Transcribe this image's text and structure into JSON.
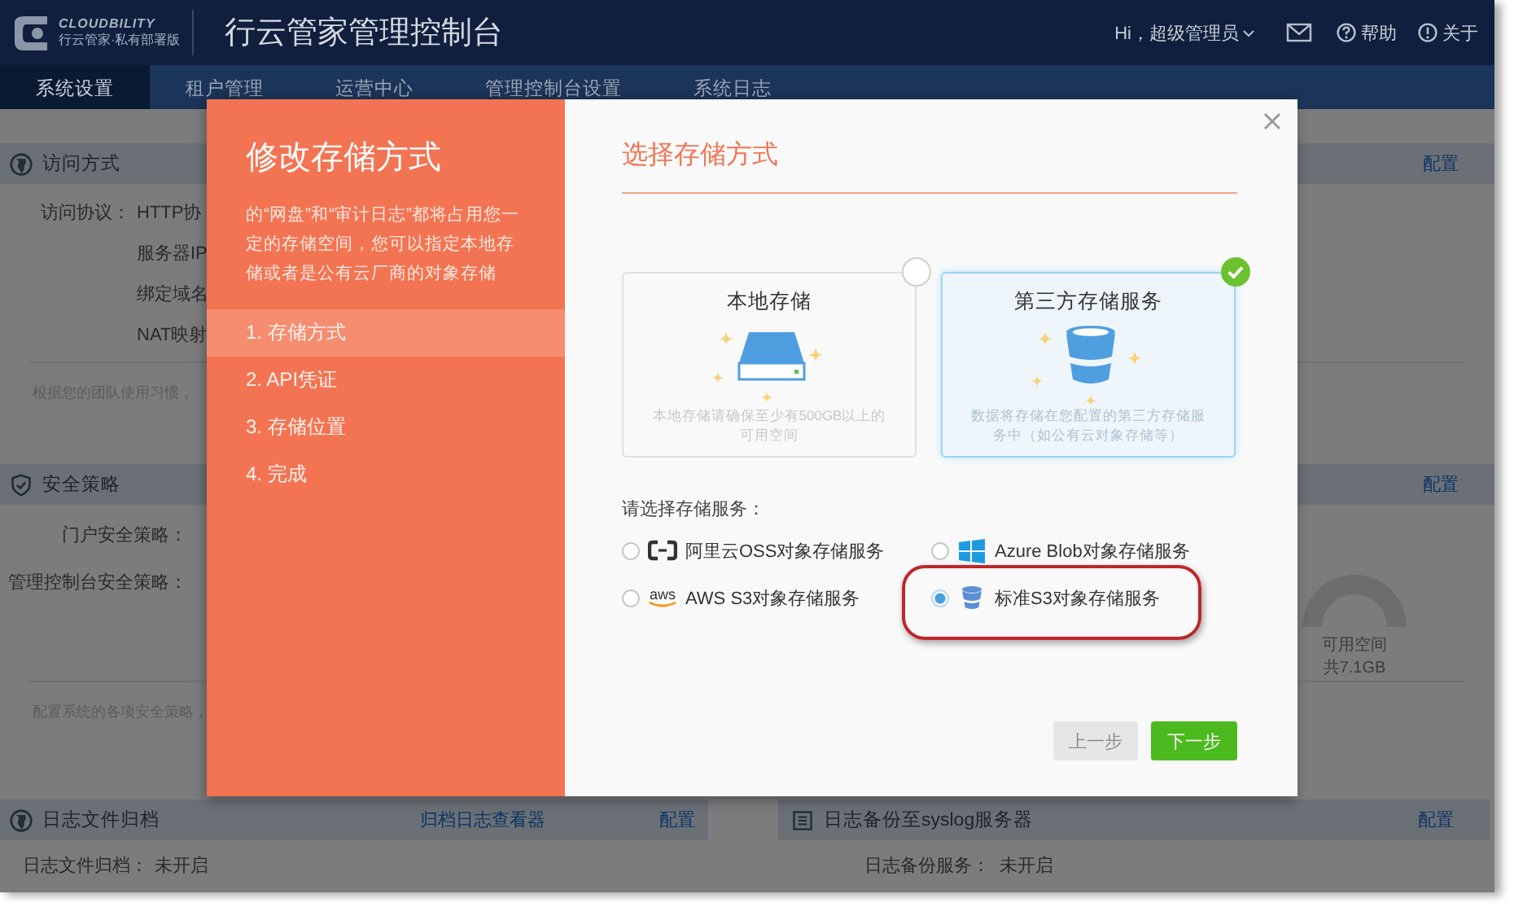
{
  "header": {
    "logo": {
      "name": "CLOUDBILITY",
      "tagline": "行云管家·私有部署版"
    },
    "title": "行云管家管理控制台",
    "user": "Hi，超级管理员",
    "links": [
      {
        "kind": "mail"
      },
      {
        "kind": "help",
        "label": "帮助"
      },
      {
        "kind": "about",
        "label": "关于"
      }
    ]
  },
  "nav": [
    {
      "label": "系统设置",
      "selected": true
    },
    {
      "label": "租户管理",
      "selected": false
    },
    {
      "label": "运营中心",
      "selected": false
    },
    {
      "label": "管理控制台设置",
      "selected": false
    },
    {
      "label": "系统日志",
      "selected": false
    }
  ],
  "sections": [
    {
      "title": "访问方式",
      "action": "配置",
      "rows": [
        {
          "label": "访问协议：",
          "value": "HTTP协"
        },
        {
          "value": "服务器IP"
        },
        {
          "value": "绑定域名"
        },
        {
          "value": "NAT映射"
        }
      ],
      "note": "根据您的团队使用习惯，"
    },
    {
      "title": "安全策略",
      "action": "配置",
      "rows": [
        {
          "label": "门户安全策略："
        },
        {
          "label": "管理控制台安全策略："
        }
      ],
      "note": "配置系统的各项安全策略，",
      "gauge": {
        "label": "可用空间",
        "total": "共7.1GB"
      }
    }
  ],
  "bottom_panels": [
    {
      "title": "日志文件归档",
      "link": "归档日志查看器",
      "action": "配置",
      "rows": [
        {
          "label": "日志文件归档：",
          "value": "未开启"
        }
      ]
    },
    {
      "title": "日志备份至syslog服务器",
      "action": "配置",
      "rows": [
        {
          "label": "日志备份服务：",
          "value": "未开启"
        }
      ]
    }
  ],
  "dialog": {
    "title": "修改存储方式",
    "description": "的“网盘”和“审计日志”都将占用您一定的存储空间，您可以指定本地存储或者是公有云厂商的对象存储",
    "steps": [
      {
        "label": "1. 存储方式",
        "selected": true
      },
      {
        "label": "2. API凭证",
        "selected": false
      },
      {
        "label": "3. 存储位置",
        "selected": false
      },
      {
        "label": "4. 完成",
        "selected": false
      }
    ],
    "heading": "选择存储方式",
    "options": [
      {
        "kind": "disk",
        "title": "本地存储",
        "description": "本地存储请确保至少有500GB以上的可用空间",
        "selected": false
      },
      {
        "kind": "bucket",
        "title": "第三方存储服务",
        "description": "数据将存储在您配置的第三方存储服务中（如公有云对象存储等）",
        "selected": true
      }
    ],
    "service_label": "请选择存储服务：",
    "services": [
      {
        "kind": "aliyun",
        "label": "阿里云OSS对象存储服务",
        "selected": false,
        "highlighted": false
      },
      {
        "kind": "azure",
        "label": "Azure Blob对象存储服务",
        "selected": false,
        "highlighted": false
      },
      {
        "kind": "aws",
        "logo_text": "aws",
        "label": "AWS S3对象存储服务",
        "selected": false,
        "highlighted": false
      },
      {
        "kind": "s3",
        "label": "标准S3对象存储服务",
        "selected": true,
        "highlighted": true
      }
    ],
    "buttons": [
      {
        "label": "上一步",
        "kind": "secondary",
        "disabled": true
      },
      {
        "label": "下一步",
        "kind": "primary",
        "disabled": false
      }
    ]
  }
}
